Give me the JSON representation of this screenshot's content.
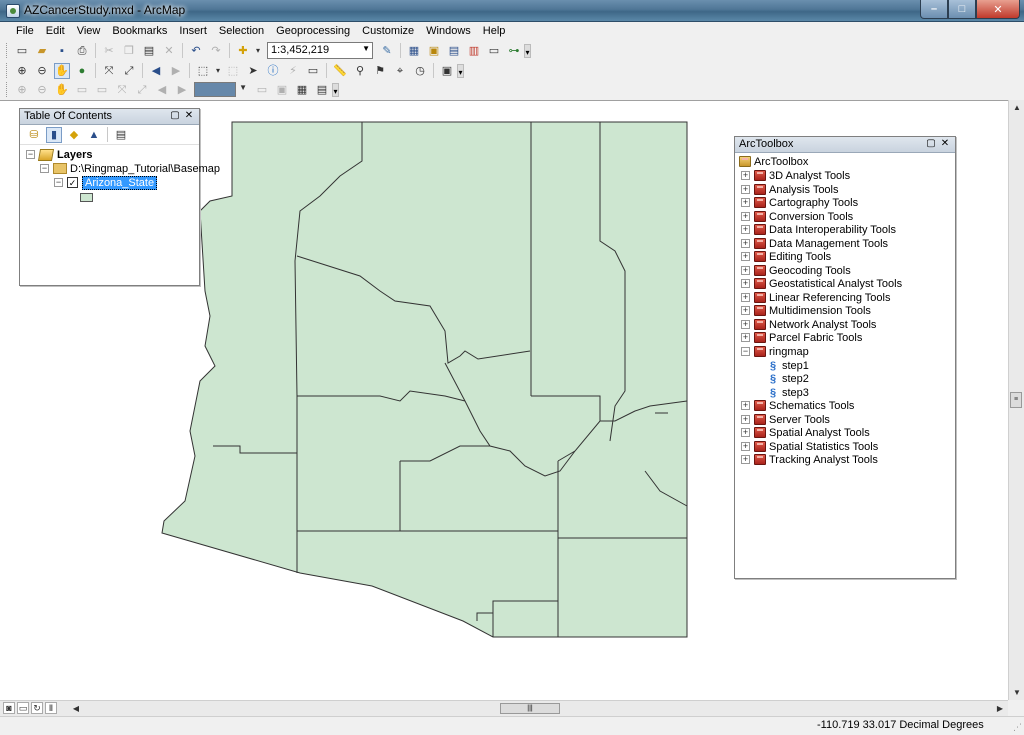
{
  "window": {
    "title": "AZCancerStudy.mxd - ArcMap",
    "minimize": "–",
    "maximize": "□",
    "close": "✕"
  },
  "menu": [
    "File",
    "Edit",
    "View",
    "Bookmarks",
    "Insert",
    "Selection",
    "Geoprocessing",
    "Customize",
    "Windows",
    "Help"
  ],
  "toolbar": {
    "scale": "1:3,452,219"
  },
  "toc": {
    "title": "Table Of Contents",
    "layers_label": "Layers",
    "folder_label": "D:\\Ringmap_Tutorial\\Basemap",
    "layer_label": "Arizona_State",
    "layer_checked": "✓",
    "swatch_color": "#cde6d0"
  },
  "toolbox": {
    "title": "ArcToolbox",
    "root": "ArcToolbox",
    "items": [
      "3D Analyst Tools",
      "Analysis Tools",
      "Cartography Tools",
      "Conversion Tools",
      "Data Interoperability Tools",
      "Data Management Tools",
      "Editing Tools",
      "Geocoding Tools",
      "Geostatistical Analyst Tools",
      "Linear Referencing Tools",
      "Multidimension Tools",
      "Network Analyst Tools",
      "Parcel Fabric Tools",
      "ringmap"
    ],
    "scripts": [
      "step1",
      "step2",
      "step3"
    ],
    "items_after": [
      "Schematics Tools",
      "Server Tools",
      "Spatial Analyst Tools",
      "Spatial Statistics Tools",
      "Tracking Analyst Tools"
    ]
  },
  "map": {
    "fill_color": "#cde6d0",
    "stroke_color": "#333333"
  },
  "status": {
    "coords": "-110.719  33.017 Decimal Degrees"
  }
}
